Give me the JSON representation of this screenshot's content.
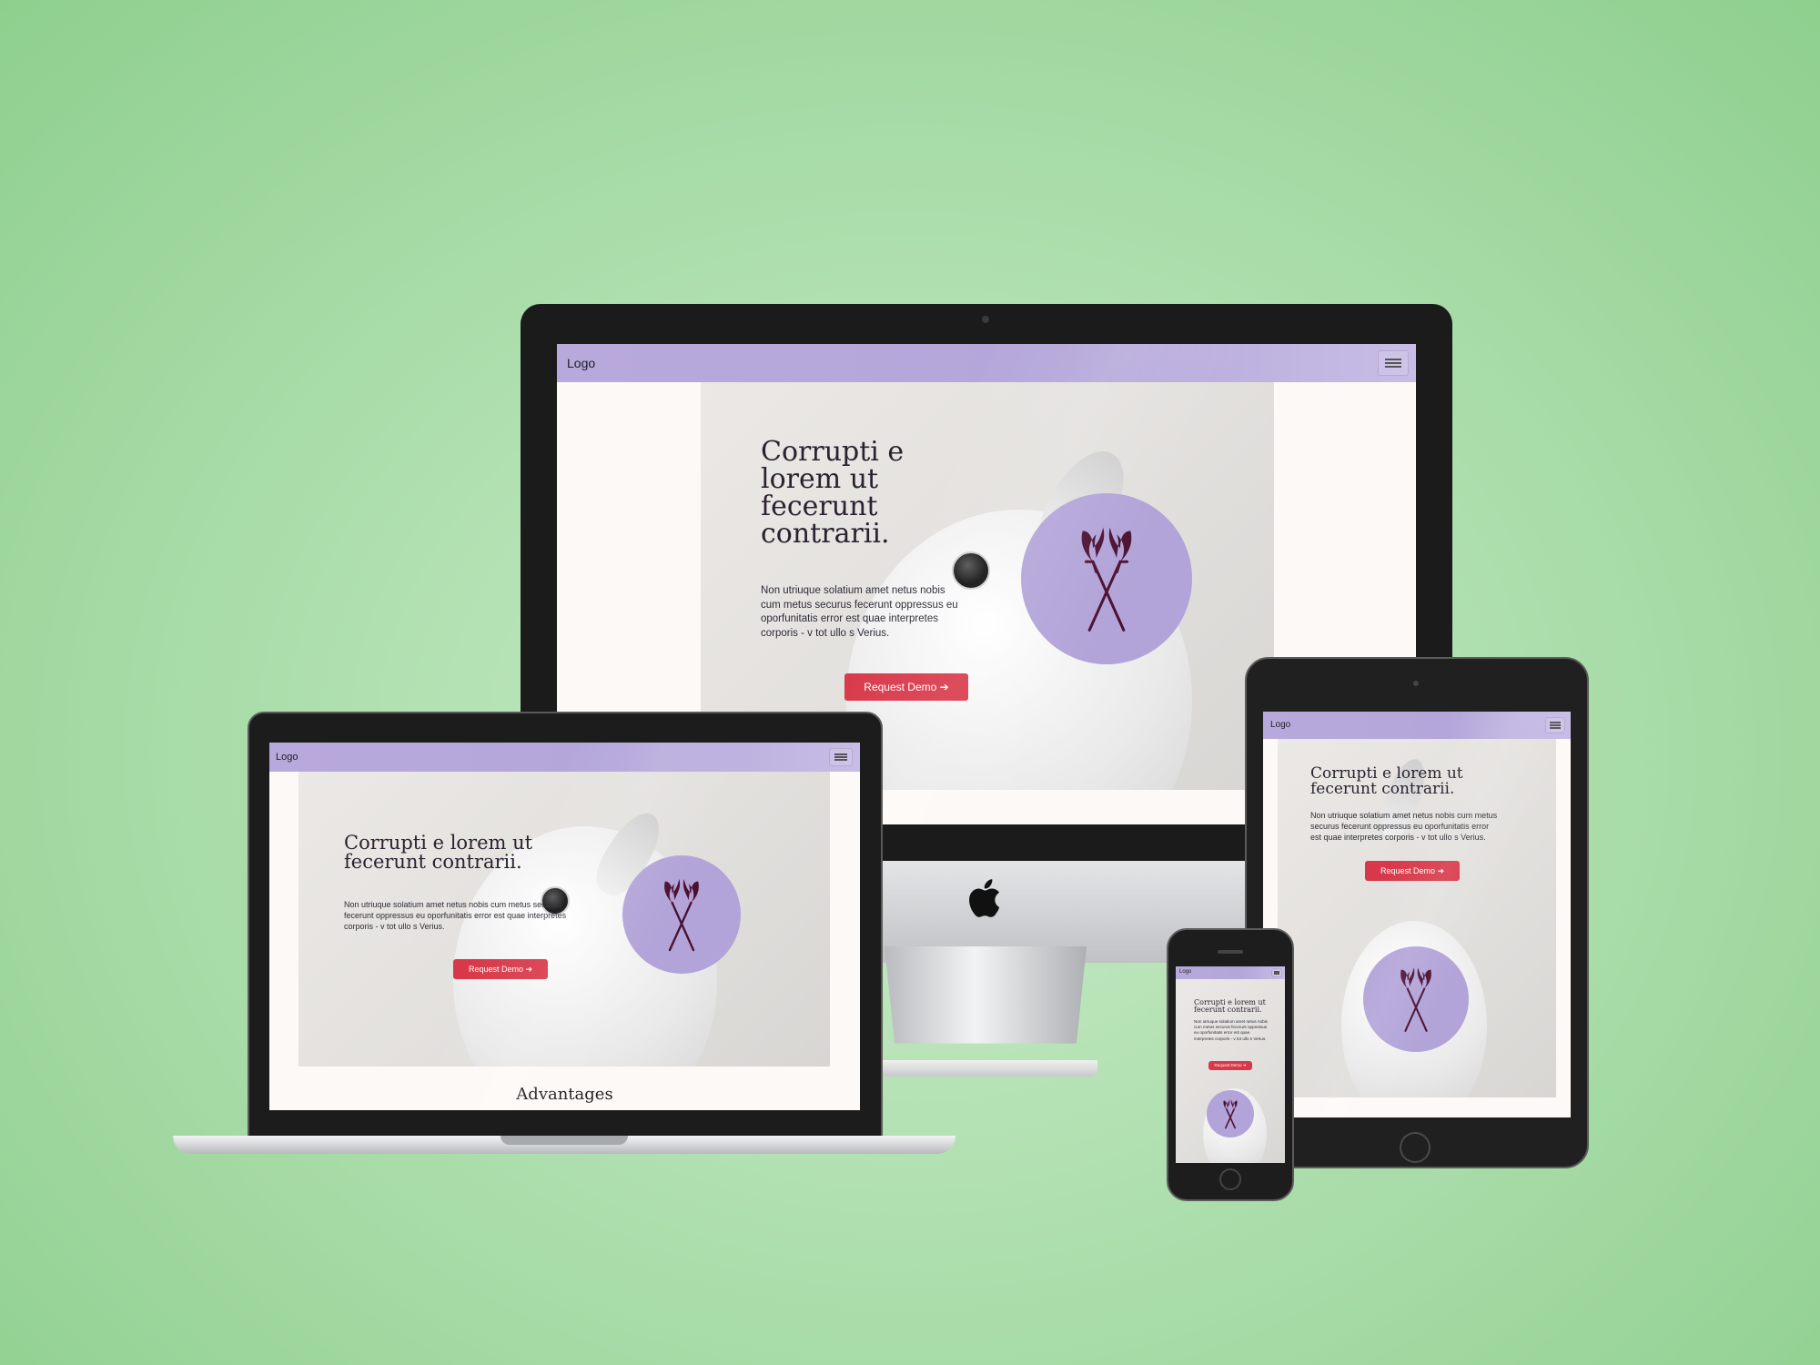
{
  "brand": {
    "accent": "#b7a8dc",
    "cta": "#d8394a",
    "background": "#a9dca9"
  },
  "site": {
    "logo": "Logo",
    "menu_icon": "hamburger-icon",
    "headline": "Corrupti e lorem ut fecerunt contrarii.",
    "paragraph": "Non utriuque solatium amet netus nobis cum metus securus fecerunt oppressus eu oporfunitatis error est quae interpretes corporis - v tot ullo s Verius.",
    "cta_label": "Request Demo ➔",
    "section_title": "Advantages"
  },
  "devices": {
    "imac": {
      "hardware_logo": "apple-icon"
    }
  }
}
